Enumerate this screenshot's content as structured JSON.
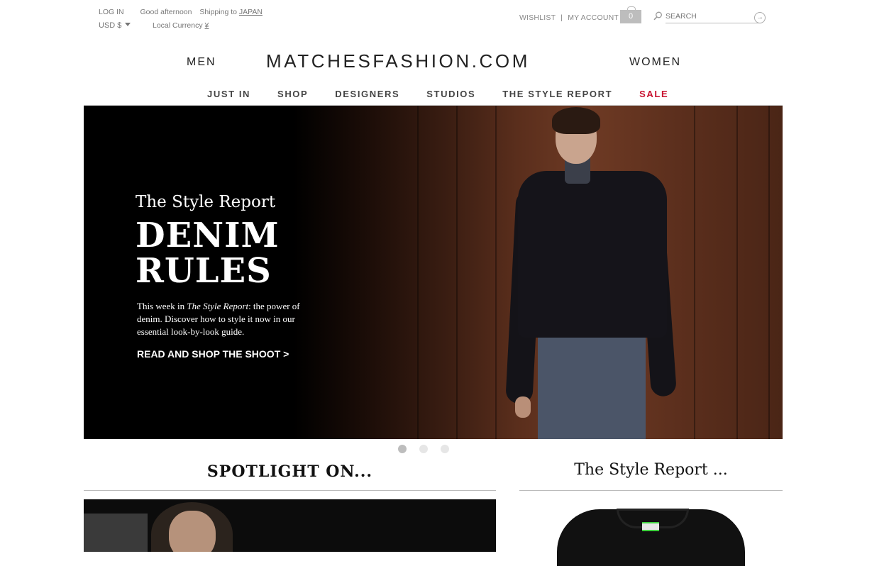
{
  "utility": {
    "login": "LOG IN",
    "greeting": "Good afternoon",
    "shipping_prefix": "Shipping to",
    "shipping_country": "JAPAN",
    "currency": "USD $",
    "local_currency_label": "Local Currency",
    "local_currency_symbol": "¥"
  },
  "account": {
    "wishlist": "WISHLIST",
    "separator": "|",
    "my_account": "MY ACCOUNT",
    "bag_count": "0",
    "search_placeholder": "SEARCH"
  },
  "brand": {
    "men": "MEN",
    "logo": "MATCHESFASHION.COM",
    "women": "WOMEN"
  },
  "nav": {
    "items": [
      "JUST IN",
      "SHOP",
      "DESIGNERS",
      "STUDIOS",
      "THE STYLE REPORT",
      "SALE"
    ],
    "sale_color": "#c8102e"
  },
  "hero": {
    "label": "The Style Report",
    "headline_line1": "DENIM",
    "headline_line2": "RULES",
    "copy_prefix": "This week in",
    "copy_italic": "The Style Report",
    "copy_suffix": ": the power of denim. Discover how to style it now in our essential look-by-look guide.",
    "cta": "READ AND SHOP THE SHOOT >"
  },
  "carousel": {
    "count": 3,
    "active_index": 0
  },
  "sections": {
    "spotlight_title": "SPOTLIGHT ON...",
    "style_report_title": "The Style Report ..."
  }
}
